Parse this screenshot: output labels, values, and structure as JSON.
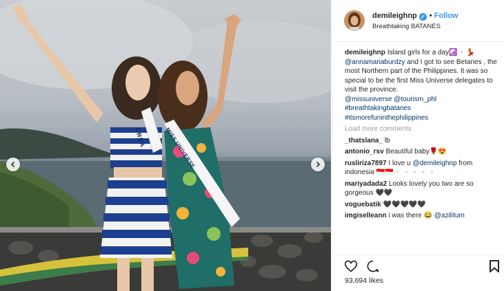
{
  "post": {
    "username": "demileighnp",
    "follow_label": "Follow",
    "location": "Breathtaking BATANES",
    "caption_user": "demileighnp",
    "caption_text": "Island girls for a day☯️▫️💃",
    "caption_mention": "@annamariaburdzy",
    "caption_text2": " and I got to see Betanes , the most Northern part of the Philippines. It was so special to be the first Miss Universe delegates to visit the province.",
    "caption_tags": [
      "@missuniverse",
      "@tourism_phl",
      "#breathtakingbatanes",
      "#itsmorefuninthephilippines"
    ],
    "load_more": "Load more comments",
    "likes": "93,694 likes"
  },
  "comments": [
    {
      "user": "_thatslana_",
      "text": "lb"
    },
    {
      "user": "antonio_rsv",
      "text": "Beautiful baby🌹😍"
    },
    {
      "user": "rusliriza7897",
      "text": "I love u ",
      "mention": "@demileighnp",
      "text2": " from indonesia 🇮🇩🇮🇩▫️▫️▫️▫️▫️"
    },
    {
      "user": "mariyadada2",
      "text": "Looks lovely you two are so gorgeous 🖤🖤"
    },
    {
      "user": "voguebatik",
      "text": "🖤🖤🖤🖤🖤"
    },
    {
      "user": "imgiselleann",
      "text": "i was there 😂 ",
      "mention": "@azilitum"
    }
  ],
  "sash_labels": [
    "GREA",
    "MISS UNIVERSE"
  ],
  "icons": {
    "like": "heart-icon",
    "comment": "comment-icon",
    "save": "bookmark-icon",
    "prev": "chevron-left-icon",
    "next": "chevron-right-icon",
    "verified": "verified-badge-icon"
  },
  "colors": {
    "accent": "#3897f0",
    "link": "#003569",
    "text": "#262626",
    "muted": "#999999"
  }
}
